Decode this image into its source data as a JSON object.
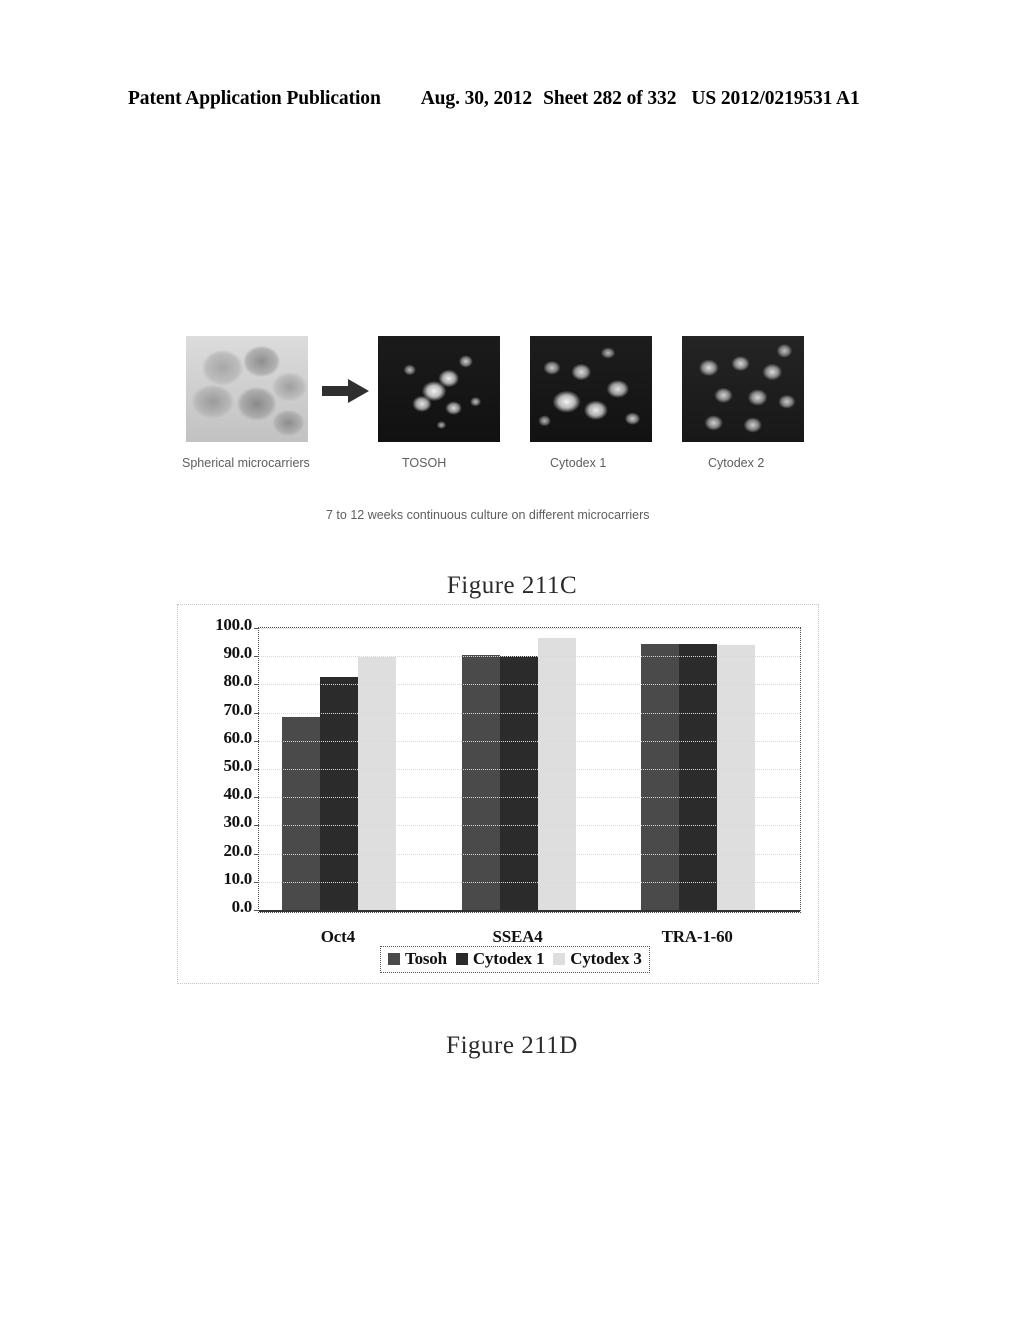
{
  "header": {
    "publication": "Patent Application Publication",
    "date": "Aug. 30, 2012",
    "sheet": "Sheet 282 of 332",
    "patent_number": "US 2012/0219531 A1"
  },
  "figure_211c": {
    "caption": "Figure 211C",
    "panels": [
      {
        "label": "Spherical microcarriers",
        "icon": "brightfield-micrograph"
      },
      {
        "label": "TOSOH",
        "icon": "fluorescence-micrograph"
      },
      {
        "label": "Cytodex 1",
        "icon": "fluorescence-micrograph"
      },
      {
        "label": "Cytodex 2",
        "icon": "fluorescence-micrograph"
      }
    ],
    "arrow_icon": "right-arrow-icon",
    "note": "7 to 12 weeks continuous culture on different microcarriers"
  },
  "figure_211d": {
    "caption": "Figure 211D"
  },
  "chart_data": {
    "type": "bar",
    "title": "",
    "xlabel": "",
    "ylabel": "",
    "ylim": [
      0,
      100
    ],
    "yticks": [
      "0.0",
      "10.0",
      "20.0",
      "30.0",
      "40.0",
      "50.0",
      "60.0",
      "70.0",
      "80.0",
      "90.0",
      "100.0"
    ],
    "categories": [
      "Oct4",
      "SSEA4",
      "TRA-1-60"
    ],
    "grid": true,
    "legend_position": "bottom",
    "series": [
      {
        "name": "Tosoh",
        "color": "#4a4a4a",
        "values": [
          68.5,
          90.5,
          94.5
        ]
      },
      {
        "name": "Cytodex 1",
        "color": "#2b2b2b",
        "values": [
          82.5,
          90.0,
          94.3
        ]
      },
      {
        "name": "Cytodex 3",
        "color": "#dedede",
        "values": [
          89.8,
          96.3,
          94.0
        ]
      }
    ]
  }
}
